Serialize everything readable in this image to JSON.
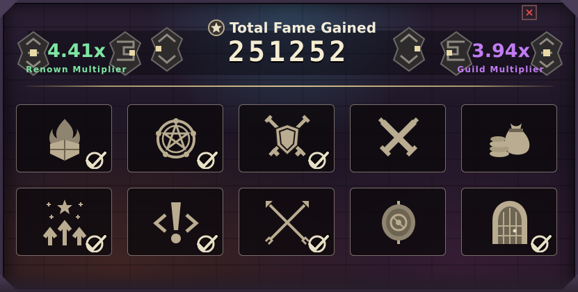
{
  "header": {
    "title": "Total Fame Gained",
    "fame_value": "251252"
  },
  "multipliers": {
    "renown": {
      "value": "4.41x",
      "label": "Renown Multiplier",
      "color": "#7de6a2"
    },
    "guild": {
      "value": "3.94x",
      "label": "Guild Multiplier",
      "color": "#c17cf2"
    }
  },
  "icons": {
    "close": "close-icon",
    "fame": "star-medal-icon"
  },
  "bonuses": [
    {
      "icon": "flame-shield-icon",
      "completed": true
    },
    {
      "icon": "pentagram-circle-icon",
      "completed": true
    },
    {
      "icon": "crossed-swords-shield-icon",
      "completed": true
    },
    {
      "icon": "crossed-swords-icon",
      "completed": false
    },
    {
      "icon": "treasure-bags-icon",
      "completed": false
    },
    {
      "icon": "star-arrows-up-icon",
      "completed": true
    },
    {
      "icon": "exclamation-diamond-icon",
      "completed": true
    },
    {
      "icon": "crossed-arrows-icon",
      "completed": true
    },
    {
      "icon": "target-eye-icon",
      "completed": false
    },
    {
      "icon": "dungeon-door-icon",
      "completed": true
    }
  ],
  "colors": {
    "tile_border": "#7a6d6a",
    "icon_fill": "#b9ac90",
    "check_fill": "#e8e0c6"
  }
}
